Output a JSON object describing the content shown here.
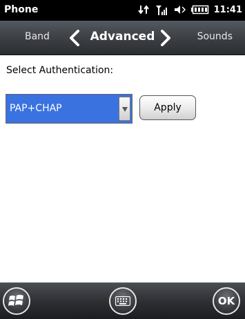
{
  "status_bar": {
    "title": "Phone",
    "time": "11:41",
    "icons": [
      "data-sync-icon",
      "signal-icon",
      "speaker-icon",
      "battery-icon"
    ]
  },
  "nav": {
    "prev_label": "Band",
    "title": "Advanced",
    "next_label": "Sounds"
  },
  "content": {
    "auth_label": "Select Authentication:",
    "auth_selected": "PAP+CHAP",
    "apply_label": "Apply"
  },
  "bottom_bar": {
    "ok_label": "OK",
    "start_icon": "windows-start-icon",
    "keyboard_icon": "keyboard-icon"
  },
  "colors": {
    "selection": "#3a72e0",
    "nav_bg": "#3f4247",
    "content_bg": "#ffffff"
  }
}
